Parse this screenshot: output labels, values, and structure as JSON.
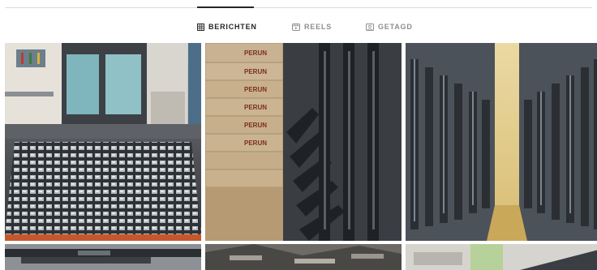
{
  "tabs": [
    {
      "label": "BERICHTEN",
      "icon": "grid-icon",
      "active": true
    },
    {
      "label": "REELS",
      "icon": "reels-icon",
      "active": false
    },
    {
      "label": "GETAGD",
      "icon": "tagged-icon",
      "active": false
    }
  ],
  "posts": {
    "box_stamp_text": "PERUN"
  },
  "colors": {
    "active_tab": "#262626",
    "inactive_tab": "#8e8e8e",
    "divider": "#dbdbdb"
  }
}
